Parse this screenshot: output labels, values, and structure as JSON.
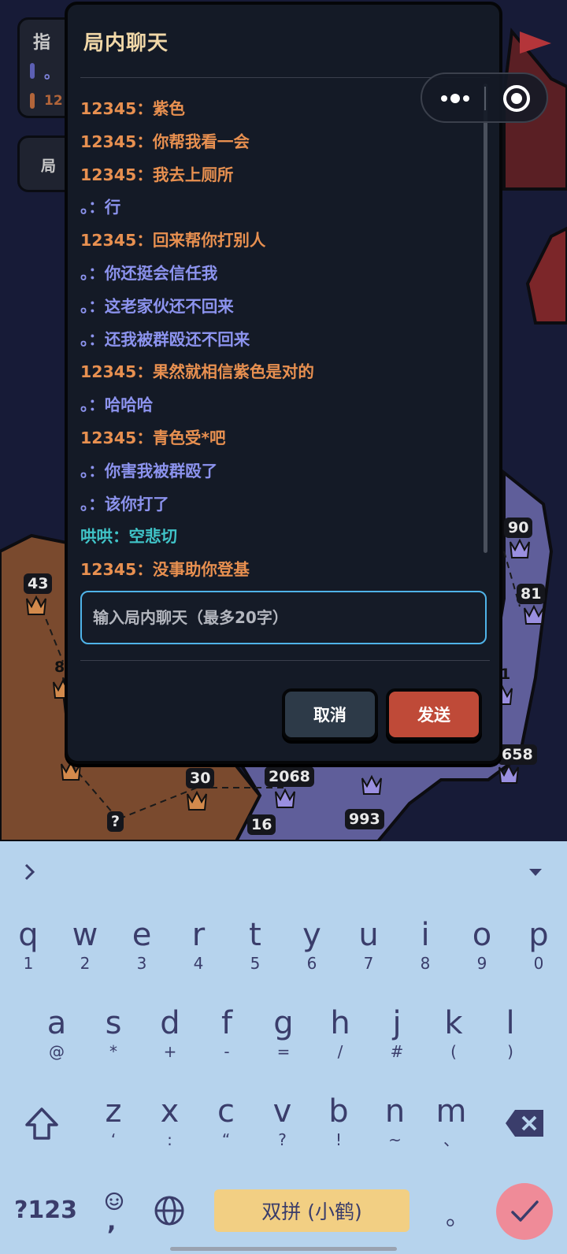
{
  "dialog": {
    "title": "局内聊天",
    "input_placeholder": "输入局内聊天（最多20字）",
    "cancel_label": "取消",
    "send_label": "发送"
  },
  "colors": {
    "player_12345": "#e89050",
    "player_dot": "#8c93ee",
    "player_honghong": "#40c4c8",
    "keyboard_bg": "#b6d3ed",
    "send_button": "#bf4a38"
  },
  "messages": [
    {
      "text": "12345：紫色",
      "sender": "12345"
    },
    {
      "text": "12345：你帮我看一会",
      "sender": "12345"
    },
    {
      "text": "12345：我去上厕所",
      "sender": "12345"
    },
    {
      "text": "。：行",
      "sender": "dot"
    },
    {
      "text": "12345：回来帮你打别人",
      "sender": "12345"
    },
    {
      "text": "。：你还挺会信任我",
      "sender": "dot"
    },
    {
      "text": "。：这老家伙还不回来",
      "sender": "dot"
    },
    {
      "text": "。：还我被群殴还不回来",
      "sender": "dot"
    },
    {
      "text": "12345：果然就相信紫色是对的",
      "sender": "12345"
    },
    {
      "text": "。：哈哈哈",
      "sender": "dot"
    },
    {
      "text": "12345：青色受*吧",
      "sender": "12345"
    },
    {
      "text": "。：你害我被群殴了",
      "sender": "dot"
    },
    {
      "text": "。：该你打了",
      "sender": "dot"
    },
    {
      "text": "哄哄：空悲切",
      "sender": "honghong"
    },
    {
      "text": "12345：没事助你登基",
      "sender": "12345"
    }
  ],
  "background": {
    "panel_title": "指",
    "legend_dot": "。",
    "legend_12": "12",
    "panel2_label": "局",
    "map_numbers": [
      "90",
      "81",
      "43",
      "8",
      "1",
      "658",
      "30",
      "2068",
      "993",
      "16",
      "?"
    ]
  },
  "capsule": {
    "icons": [
      "more-dots-icon",
      "target-icon"
    ]
  },
  "keyboard": {
    "row1": [
      {
        "k": "q",
        "s": "1"
      },
      {
        "k": "w",
        "s": "2"
      },
      {
        "k": "e",
        "s": "3"
      },
      {
        "k": "r",
        "s": "4"
      },
      {
        "k": "t",
        "s": "5"
      },
      {
        "k": "y",
        "s": "6"
      },
      {
        "k": "u",
        "s": "7"
      },
      {
        "k": "i",
        "s": "8"
      },
      {
        "k": "o",
        "s": "9"
      },
      {
        "k": "p",
        "s": "0"
      }
    ],
    "row2": [
      {
        "k": "a",
        "s": "@"
      },
      {
        "k": "s",
        "s": "*"
      },
      {
        "k": "d",
        "s": "+"
      },
      {
        "k": "f",
        "s": "-"
      },
      {
        "k": "g",
        "s": "="
      },
      {
        "k": "h",
        "s": "/"
      },
      {
        "k": "j",
        "s": "#"
      },
      {
        "k": "k",
        "s": "("
      },
      {
        "k": "l",
        "s": ")"
      }
    ],
    "row3": [
      {
        "k": "z",
        "s": "‘"
      },
      {
        "k": "x",
        "s": ":"
      },
      {
        "k": "c",
        "s": "“"
      },
      {
        "k": "v",
        "s": "?"
      },
      {
        "k": "b",
        "s": "!"
      },
      {
        "k": "n",
        "s": "~"
      },
      {
        "k": "m",
        "s": "、"
      }
    ],
    "symbols_label": "?123",
    "emoji_sub": ",",
    "space_label": "双拼 (小鹤)",
    "period_label": "。"
  }
}
